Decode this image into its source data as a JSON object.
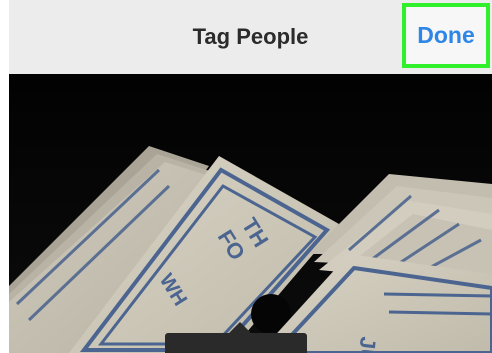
{
  "header": {
    "title": "Tag People",
    "done_label": "Done"
  },
  "photo": {
    "description_icon": "photo-image",
    "card_text_1": "TH",
    "card_text_2": "FO",
    "card_text_3": "WH",
    "card_text_4": "JU"
  },
  "colors": {
    "nav_background": "#ececec",
    "done_text": "#2e86e6",
    "highlight_border": "#2ff02b",
    "photo_background": "#050505"
  }
}
